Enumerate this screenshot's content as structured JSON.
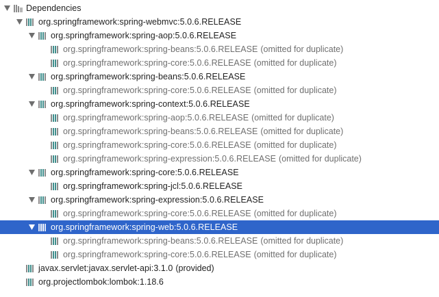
{
  "tree": {
    "root": {
      "label": "Dependencies",
      "icon": "folder-library-icon"
    },
    "nodes": [
      {
        "label": "org.springframework:spring-webmvc:5.0.6.RELEASE",
        "suffix": "",
        "depth": 1,
        "expanded": true,
        "omitted": false,
        "selected": false,
        "children": [
          {
            "label": "org.springframework:spring-aop:5.0.6.RELEASE",
            "suffix": "",
            "depth": 2,
            "expanded": true,
            "omitted": false,
            "selected": false,
            "children": [
              {
                "label": "org.springframework:spring-beans:5.0.6.RELEASE",
                "suffix": "(omitted for duplicate)",
                "depth": 3,
                "omitted": true
              },
              {
                "label": "org.springframework:spring-core:5.0.6.RELEASE",
                "suffix": "(omitted for duplicate)",
                "depth": 3,
                "omitted": true
              }
            ]
          },
          {
            "label": "org.springframework:spring-beans:5.0.6.RELEASE",
            "suffix": "",
            "depth": 2,
            "expanded": true,
            "omitted": false,
            "selected": false,
            "children": [
              {
                "label": "org.springframework:spring-core:5.0.6.RELEASE",
                "suffix": "(omitted for duplicate)",
                "depth": 3,
                "omitted": true
              }
            ]
          },
          {
            "label": "org.springframework:spring-context:5.0.6.RELEASE",
            "suffix": "",
            "depth": 2,
            "expanded": true,
            "omitted": false,
            "selected": false,
            "children": [
              {
                "label": "org.springframework:spring-aop:5.0.6.RELEASE",
                "suffix": "(omitted for duplicate)",
                "depth": 3,
                "omitted": true
              },
              {
                "label": "org.springframework:spring-beans:5.0.6.RELEASE",
                "suffix": "(omitted for duplicate)",
                "depth": 3,
                "omitted": true
              },
              {
                "label": "org.springframework:spring-core:5.0.6.RELEASE",
                "suffix": "(omitted for duplicate)",
                "depth": 3,
                "omitted": true
              },
              {
                "label": "org.springframework:spring-expression:5.0.6.RELEASE",
                "suffix": "(omitted for duplicate)",
                "depth": 3,
                "omitted": true
              }
            ]
          },
          {
            "label": "org.springframework:spring-core:5.0.6.RELEASE",
            "suffix": "",
            "depth": 2,
            "expanded": true,
            "omitted": false,
            "selected": false,
            "children": [
              {
                "label": "org.springframework:spring-jcl:5.0.6.RELEASE",
                "suffix": "",
                "depth": 3,
                "omitted": false
              }
            ]
          },
          {
            "label": "org.springframework:spring-expression:5.0.6.RELEASE",
            "suffix": "",
            "depth": 2,
            "expanded": true,
            "omitted": false,
            "selected": false,
            "children": [
              {
                "label": "org.springframework:spring-core:5.0.6.RELEASE",
                "suffix": "(omitted for duplicate)",
                "depth": 3,
                "omitted": true
              }
            ]
          },
          {
            "label": "org.springframework:spring-web:5.0.6.RELEASE",
            "suffix": "",
            "depth": 2,
            "expanded": true,
            "omitted": false,
            "selected": true,
            "children": [
              {
                "label": "org.springframework:spring-beans:5.0.6.RELEASE",
                "suffix": "(omitted for duplicate)",
                "depth": 3,
                "omitted": true
              },
              {
                "label": "org.springframework:spring-core:5.0.6.RELEASE",
                "suffix": "(omitted for duplicate)",
                "depth": 3,
                "omitted": true
              }
            ]
          }
        ]
      },
      {
        "label": "javax.servlet:javax.servlet-api:3.1.0",
        "suffix": "(provided)",
        "depth": 1,
        "omitted": false,
        "selected": false
      },
      {
        "label": "org.projectlombok:lombok:1.18.6",
        "suffix": "",
        "depth": 1,
        "omitted": false,
        "selected": false
      }
    ]
  },
  "colors": {
    "selection_bg": "#2f65ca",
    "omitted_text": "#6f6f6f",
    "library_icon_teal": "#3f8e8c",
    "library_icon_gray": "#8a8a8a",
    "arrow": "#6e6e6e"
  },
  "icons": {
    "expand_arrow": "triangle-down-icon",
    "library": "maven-library-icon"
  }
}
